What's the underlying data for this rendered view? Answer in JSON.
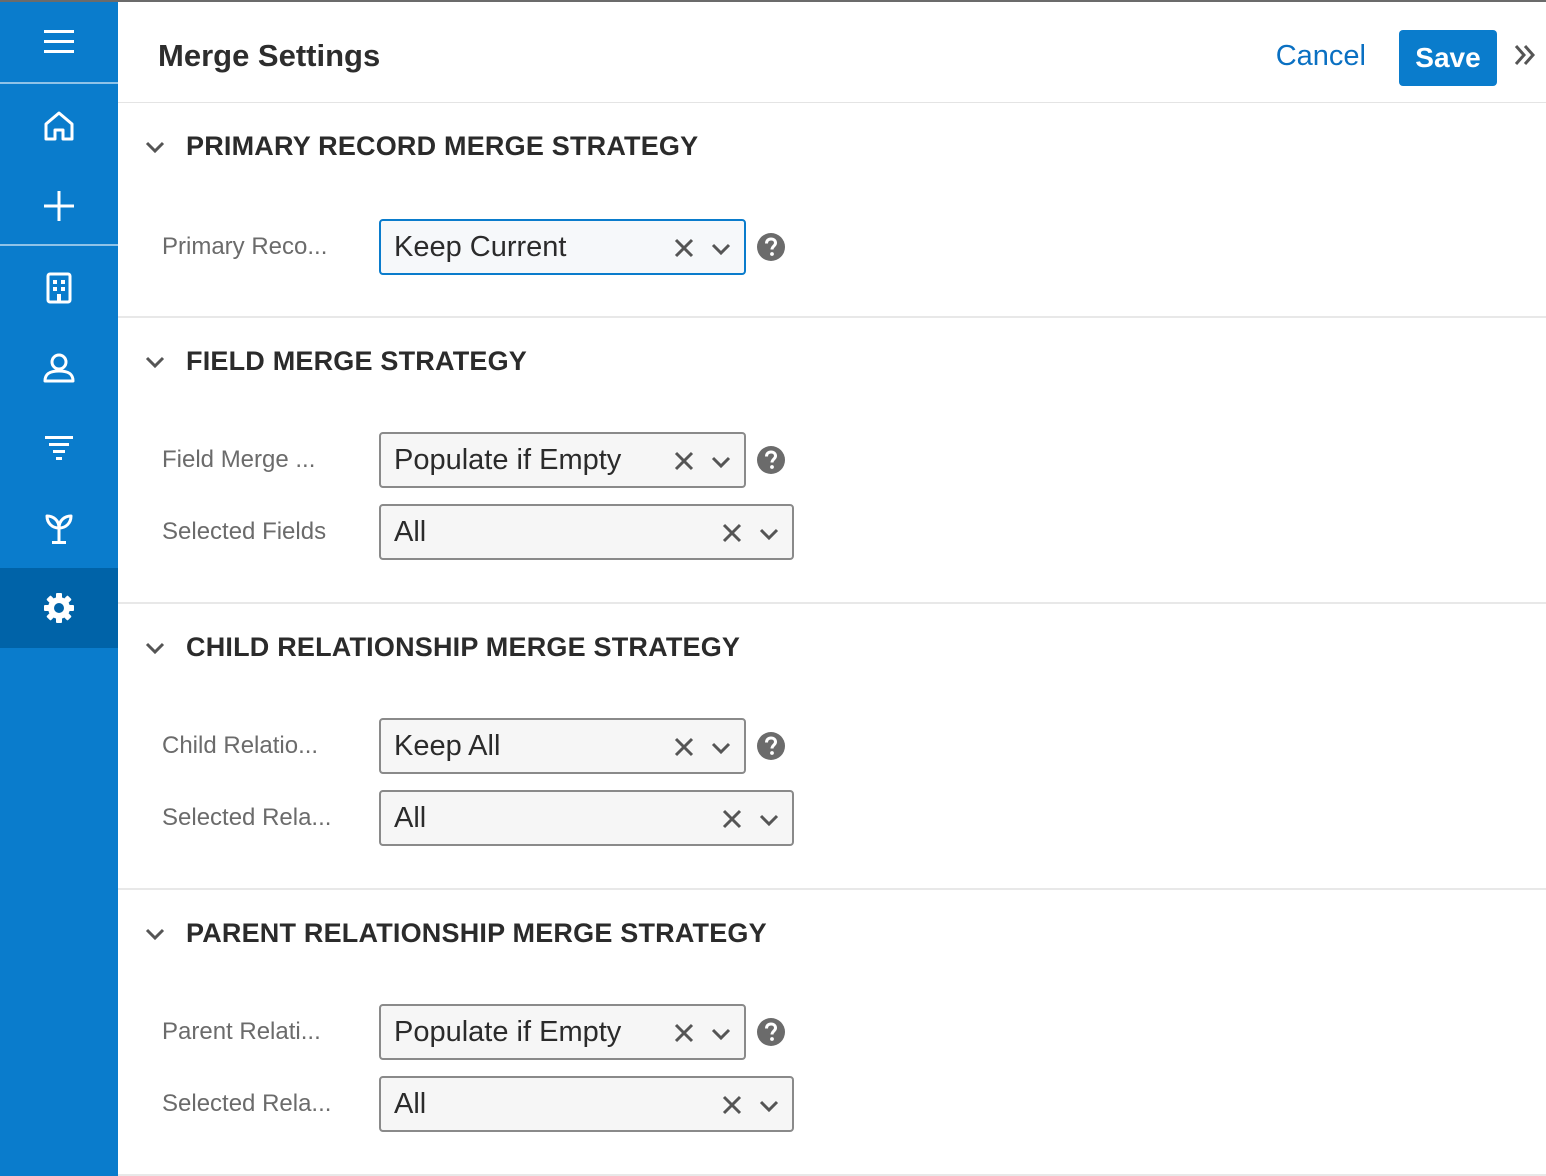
{
  "header": {
    "title": "Merge Settings",
    "cancel_label": "Cancel",
    "save_label": "Save"
  },
  "sidebar": {
    "items": [
      {
        "icon": "menu-icon"
      },
      {
        "icon": "home-icon"
      },
      {
        "icon": "plus-icon"
      },
      {
        "icon": "building-icon"
      },
      {
        "icon": "person-icon"
      },
      {
        "icon": "filter-icon"
      },
      {
        "icon": "sprout-icon"
      },
      {
        "icon": "gear-icon",
        "active": true
      }
    ]
  },
  "colors": {
    "sidebar": "#0a7ccc",
    "sidebar_active": "#0063a8",
    "accent": "#0a7ccc",
    "link": "#0a70c2"
  },
  "sections": [
    {
      "title": "PRIMARY RECORD MERGE STRATEGY",
      "rows": [
        {
          "label": "Primary Reco...",
          "value": "Keep Current",
          "help": true
        }
      ]
    },
    {
      "title": "FIELD MERGE STRATEGY",
      "rows": [
        {
          "label": "Field Merge ...",
          "value": "Populate if Empty",
          "help": true
        },
        {
          "label": "Selected Fields",
          "value": "All",
          "help": false
        }
      ]
    },
    {
      "title": "CHILD RELATIONSHIP MERGE STRATEGY",
      "rows": [
        {
          "label": "Child Relatio...",
          "value": "Keep All",
          "help": true
        },
        {
          "label": "Selected Rela...",
          "value": "All",
          "help": false
        }
      ]
    },
    {
      "title": "PARENT RELATIONSHIP MERGE STRATEGY",
      "rows": [
        {
          "label": "Parent Relati...",
          "value": "Populate if Empty",
          "help": true
        },
        {
          "label": "Selected Rela...",
          "value": "All",
          "help": false
        }
      ]
    }
  ]
}
